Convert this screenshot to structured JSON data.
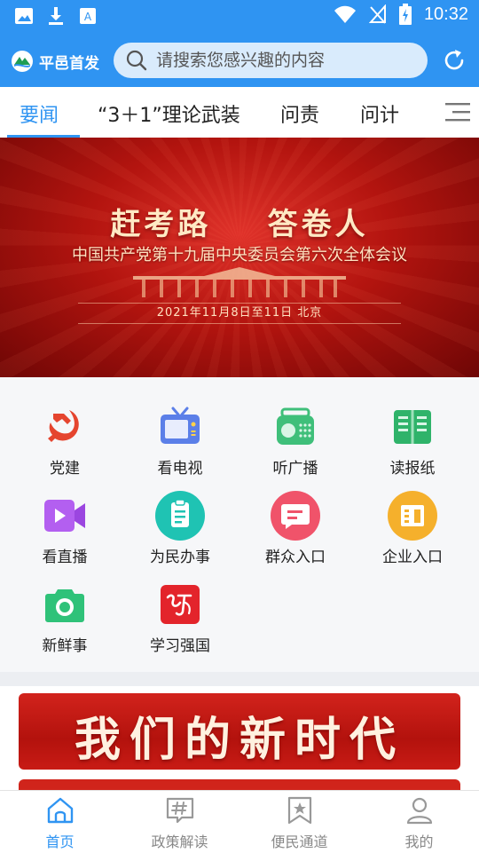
{
  "status_bar": {
    "time": "10:32"
  },
  "header": {
    "brand_name": "平邑首发",
    "search_placeholder": "请搜索您感兴趣的内容"
  },
  "tabs": [
    {
      "label": "要闻",
      "active": true
    },
    {
      "label": "“3＋1”理论武装",
      "active": false
    },
    {
      "label": "问责",
      "active": false
    },
    {
      "label": "问计",
      "active": false
    }
  ],
  "banner": {
    "title": "赶考路    答卷人",
    "subtitle": "中国共产党第十九届中央委员会第六次全体会议",
    "date_line": "2021年11月8日至11日    北京"
  },
  "grid": [
    {
      "label": "党建",
      "icon": "party-emblem-icon"
    },
    {
      "label": "看电视",
      "icon": "tv-icon"
    },
    {
      "label": "听广播",
      "icon": "radio-icon"
    },
    {
      "label": "读报纸",
      "icon": "newspaper-icon"
    },
    {
      "label": "看直播",
      "icon": "live-video-icon"
    },
    {
      "label": "为民办事",
      "icon": "clipboard-icon"
    },
    {
      "label": "群众入口",
      "icon": "chat-bubble-icon"
    },
    {
      "label": "企业入口",
      "icon": "enterprise-icon"
    },
    {
      "label": "新鲜事",
      "icon": "camera-icon"
    },
    {
      "label": "学习强国",
      "icon": "xuexi-logo-icon"
    }
  ],
  "promo": {
    "text": "我们的新时代"
  },
  "bottom_nav": [
    {
      "label": "首页",
      "icon": "home-icon",
      "active": true
    },
    {
      "label": "政策解读",
      "icon": "hashtag-chat-icon",
      "active": false
    },
    {
      "label": "便民通道",
      "icon": "bookmark-star-icon",
      "active": false
    },
    {
      "label": "我的",
      "icon": "user-icon",
      "active": false
    }
  ],
  "colors": {
    "primary": "#2f94f2",
    "banner_red": "#b3140f",
    "party_red": "#e5452f"
  }
}
